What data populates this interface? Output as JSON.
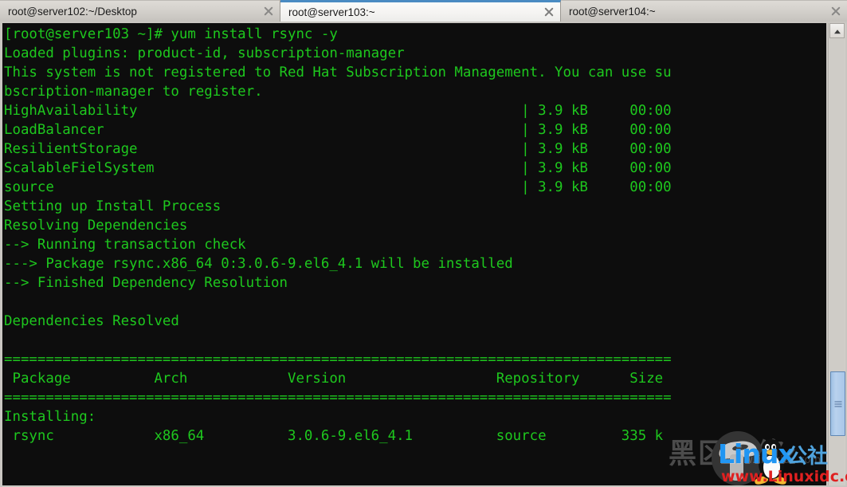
{
  "window": {
    "tabs": [
      {
        "label": "root@server102:~/Desktop",
        "active": false,
        "close_icon": "close-icon"
      },
      {
        "label": "root@server103:~",
        "active": true,
        "close_icon": "close-icon"
      },
      {
        "label": "root@server104:~",
        "active": false,
        "close_icon": "close-icon"
      }
    ]
  },
  "terminal": {
    "foreground_color": "#1ec81e",
    "background_color": "#0d0d0d",
    "prompt": "[root@server103 ~]#",
    "command": "yum install rsync -y",
    "lines": [
      "[root@server103 ~]# yum install rsync -y",
      "Loaded plugins: product-id, subscription-manager",
      "This system is not registered to Red Hat Subscription Management. You can use su",
      "bscription-manager to register.",
      "HighAvailability                                              | 3.9 kB     00:00",
      "LoadBalancer                                                  | 3.9 kB     00:00",
      "ResilientStorage                                              | 3.9 kB     00:00",
      "ScalableFielSystem                                            | 3.9 kB     00:00",
      "source                                                        | 3.9 kB     00:00",
      "Setting up Install Process",
      "Resolving Dependencies",
      "--> Running transaction check",
      "---> Package rsync.x86_64 0:3.0.6-9.el6_4.1 will be installed",
      "--> Finished Dependency Resolution",
      "",
      "Dependencies Resolved",
      "",
      "================================================================================",
      " Package          Arch            Version                  Repository      Size",
      "================================================================================",
      "Installing:",
      " rsync            x86_64          3.0.6-9.el6_4.1          source         335 k"
    ],
    "repos": [
      {
        "name": "HighAvailability",
        "size": "3.9 kB",
        "time": "00:00"
      },
      {
        "name": "LoadBalancer",
        "size": "3.9 kB",
        "time": "00:00"
      },
      {
        "name": "ResilientStorage",
        "size": "3.9 kB",
        "time": "00:00"
      },
      {
        "name": "ScalableFielSystem",
        "size": "3.9 kB",
        "time": "00:00"
      },
      {
        "name": "source",
        "size": "3.9 kB",
        "time": "00:00"
      }
    ],
    "table": {
      "headers": [
        "Package",
        "Arch",
        "Version",
        "Repository",
        "Size"
      ],
      "section_label": "Installing:",
      "rows": [
        {
          "package": "rsync",
          "arch": "x86_64",
          "version": "3.0.6-9.el6_4.1",
          "repository": "source",
          "size": "335 k"
        }
      ]
    }
  },
  "scrollbar": {
    "up_arrow_icon": "chevron-up-icon",
    "thumb_grip_icon": "grip-lines-icon"
  },
  "watermark": {
    "cjk_overlay": "黑区网络",
    "brand": "Linux",
    "brand_suffix": "公社",
    "url": "www.Linuxidc.com",
    "url_faint": "www.linuxidc.com",
    "brand_color": "#2196f3",
    "url_color": "#e02020"
  }
}
